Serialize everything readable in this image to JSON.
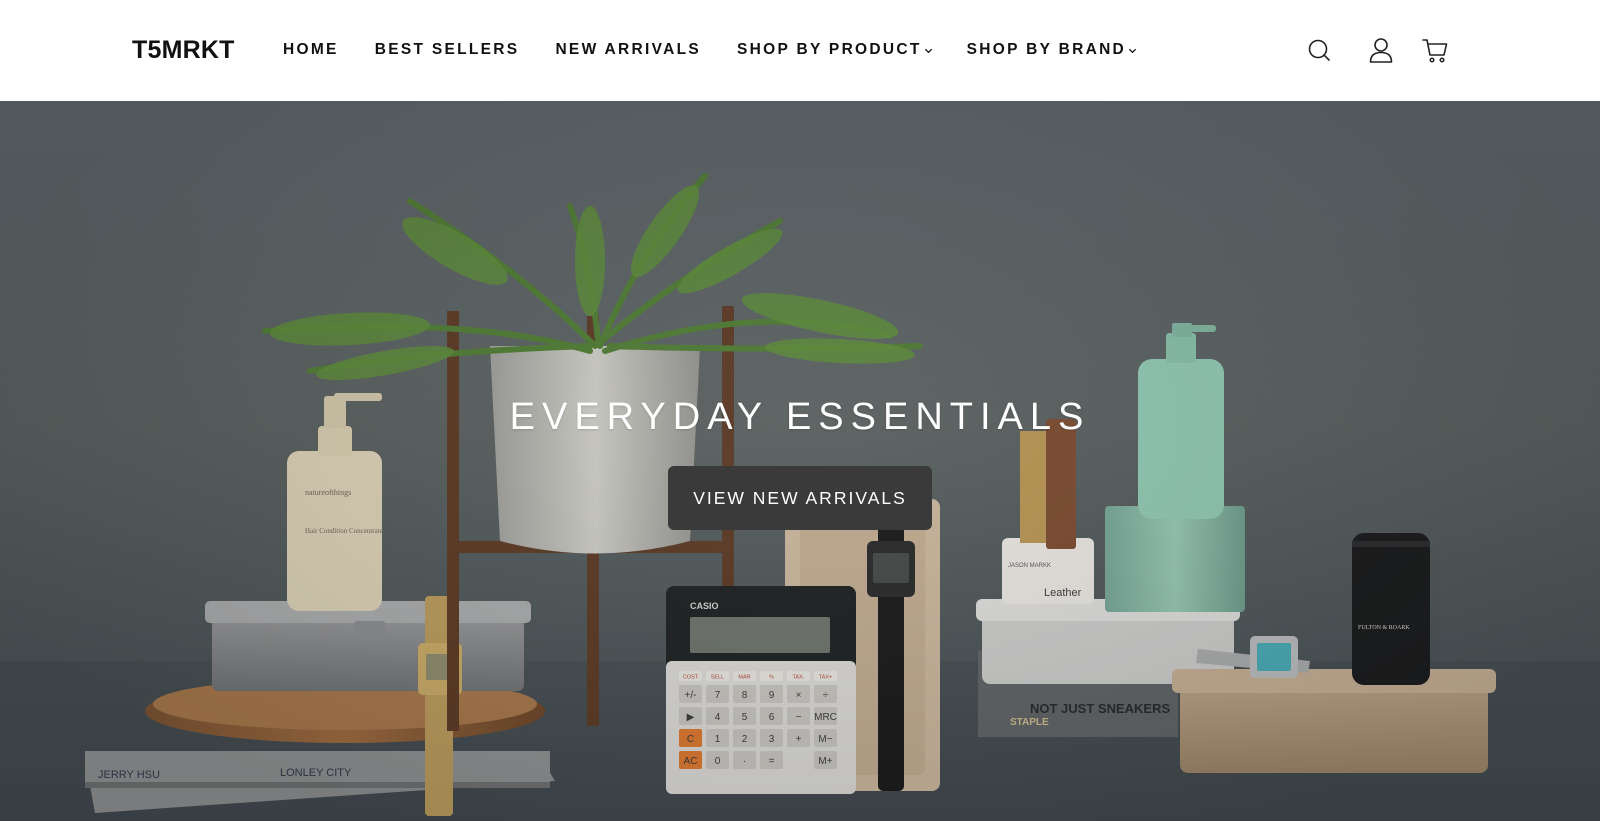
{
  "header": {
    "logo": "T5MRKT",
    "nav": {
      "home": "HOME",
      "best_sellers": "BEST SELLERS",
      "new_arrivals": "NEW ARRIVALS",
      "shop_by_product": "SHOP BY PRODUCT",
      "shop_by_brand": "SHOP BY BRAND"
    },
    "icons": [
      "search-icon",
      "account-icon",
      "cart-icon"
    ]
  },
  "hero": {
    "title": "EVERYDAY ESSENTIALS",
    "cta_label": "VIEW NEW ARRIVALS",
    "product_labels": {
      "bottle_brand": "natureofthings",
      "bottle_product": "Hair Condition Concentrate",
      "calculator_brand": "CASIO",
      "jar_label": "Leather",
      "jar_brand": "JASON MARKK",
      "canister_brand": "FULTON & ROARK",
      "book_left_author": "JERRY HSU",
      "book_left_title": "LONLEY CITY",
      "book_right_title": "NOT JUST SNEAKERS",
      "book_right_publisher": "STAPLE"
    },
    "calculator_keys": {
      "top_row": [
        "COST",
        "SELL",
        "MAR",
        "%",
        "TAX-",
        "TAX+"
      ],
      "row1": [
        "+/-",
        "7",
        "8",
        "9",
        "×",
        "÷"
      ],
      "row2": [
        "▶",
        "4",
        "5",
        "6",
        "−",
        "MRC"
      ],
      "row3": [
        "C",
        "1",
        "2",
        "3",
        "+",
        "M−"
      ],
      "row4": [
        "AC",
        "0",
        "·",
        "=",
        "",
        "M+"
      ]
    }
  },
  "colors": {
    "header_bg": "#ffffff",
    "nav_text": "#111111",
    "hero_bg": "#5a6165",
    "cta_bg": "#3a3a3b",
    "cta_text": "#ffffff"
  }
}
